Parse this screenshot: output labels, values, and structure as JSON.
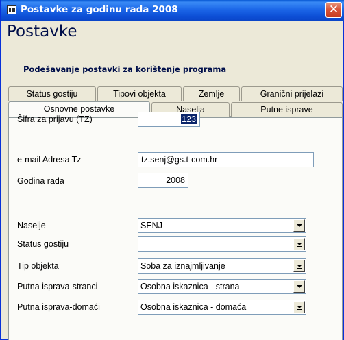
{
  "window": {
    "title": "Postavke za godinu rada 2008",
    "close_glyph": "✕",
    "icon": "form-icon"
  },
  "header": {
    "title": "Postavke",
    "subtitle": "Podešavanje postavki za korištenje programa"
  },
  "tabs": {
    "back_row": [
      "Status gostiju",
      "Tipovi objekta",
      "Zemlje",
      "Granični prijelazi"
    ],
    "front_row": [
      "Osnovne postavke",
      "Naselja",
      "Putne isprave"
    ],
    "active": "Osnovne postavke"
  },
  "form": {
    "sifra_label": "Šifra za prijavu (TZ)",
    "sifra_value": "123",
    "email_label": "e-mail Adresa Tz",
    "email_value": "tz.senj@gs.t-com.hr",
    "godina_label": "Godina rada",
    "godina_value": "2008",
    "naselje_label": "Naselje",
    "naselje_value": "SENJ",
    "status_label": "Status gostiju",
    "status_value": "",
    "tip_label": "Tip objekta",
    "tip_value": "Soba za iznajmljivanje",
    "stranci_label": "Putna isprava-stranci",
    "stranci_value": "Osobna iskaznica - strana",
    "domaci_label": "Putna isprava-domaći",
    "domaci_value": "Osobna iskaznica - domaća"
  },
  "colors": {
    "titlebar": "#0a5bd6",
    "window_bg": "#ece9d8",
    "panel_bg": "#fbfbf8",
    "selection": "#0a246a",
    "close_button": "#d9553a"
  }
}
